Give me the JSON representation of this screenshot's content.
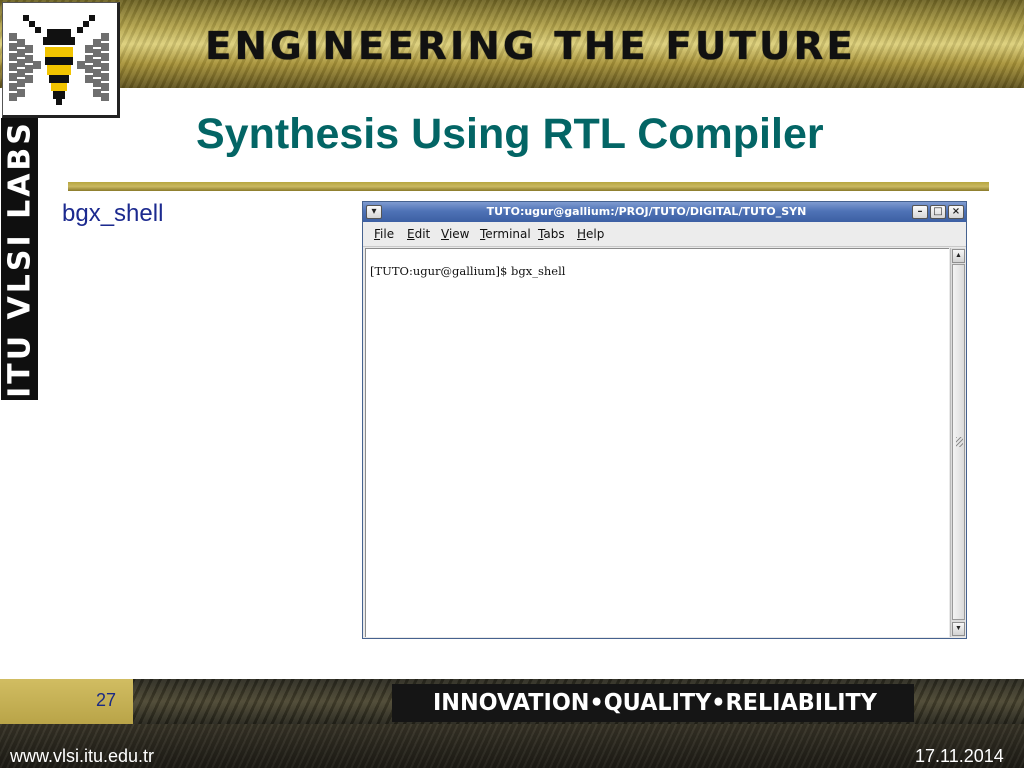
{
  "header": {
    "banner_text": "ENGINEERING THE FUTURE",
    "side_label": "ITU VLSI LABS"
  },
  "slide": {
    "title": "Synthesis Using RTL Compiler",
    "bullet": "bgx_shell"
  },
  "terminal": {
    "window_title": "TUTO:ugur@gallium:/PROJ/TUTO/DIGITAL/TUTO_SYN",
    "menu": [
      "File",
      "Edit",
      "View",
      "Terminal",
      "Tabs",
      "Help"
    ],
    "output_line": "[TUTO:ugur@gallium]$ bgx_shell",
    "title_buttons": {
      "menu_icon": "chevron-down-icon",
      "minimize_icon": "minimize-icon",
      "maximize_icon": "maximize-icon",
      "close_icon": "close-icon"
    }
  },
  "footer": {
    "page_number": "27",
    "motto": "INNOVATION•QUALITY•RELIABILITY",
    "url": "www.vlsi.itu.edu.tr",
    "date": "17.11.2014"
  },
  "colors": {
    "title": "#036565",
    "bullet": "#1c2a8f",
    "gold": "#b7a63f",
    "titlebar": "#4f73b6"
  }
}
